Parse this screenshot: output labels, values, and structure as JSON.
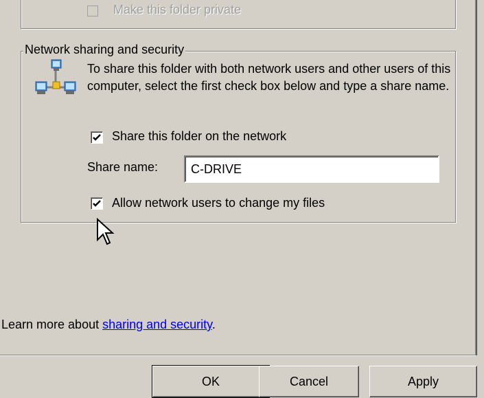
{
  "local_sharing": {
    "make_private_label": "Make this folder private",
    "make_private_checked": false,
    "make_private_enabled": false
  },
  "network_sharing": {
    "group_title": "Network sharing and security",
    "icon": "network-icon",
    "description": "To share this folder with both network users and other users of this computer, select the first check box below and type a share name.",
    "share_checkbox_label": "Share this folder on the network",
    "share_checked": true,
    "share_name_label": "Share name:",
    "share_name_value": "C-DRIVE",
    "allow_change_label": "Allow network users to change my files",
    "allow_change_checked": true
  },
  "learn_more": {
    "prefix": "Learn more about ",
    "link_text": "sharing and security",
    "suffix": "."
  },
  "buttons": {
    "ok": "OK",
    "cancel": "Cancel",
    "apply": "Apply"
  },
  "colors": {
    "dialog_bg": "#d4d0c8",
    "link": "#0000ee"
  }
}
